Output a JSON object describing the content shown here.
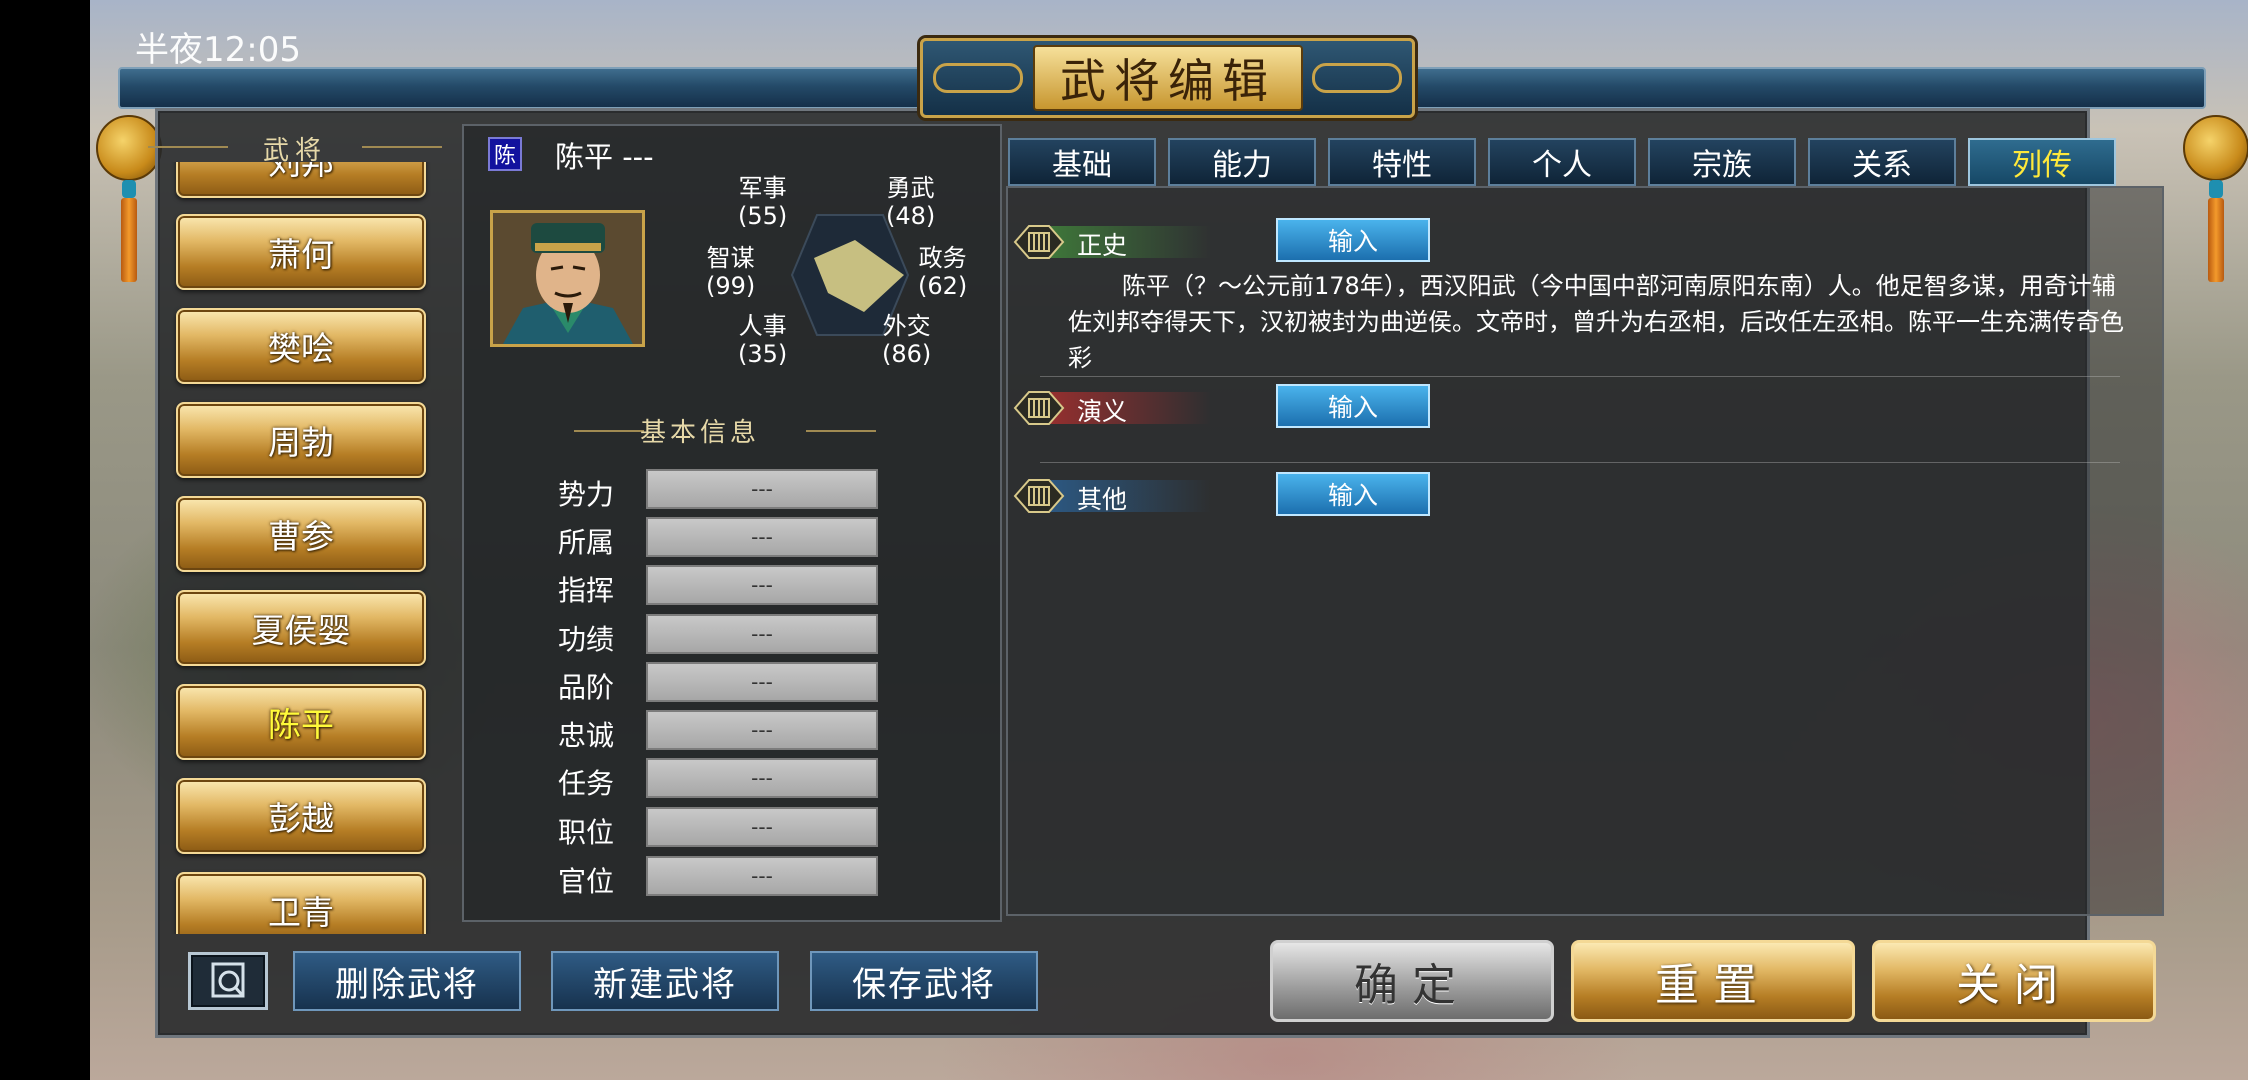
{
  "status": {
    "time": "半夜12:05"
  },
  "window": {
    "title": "武将编辑"
  },
  "list": {
    "header": "武将",
    "items": [
      {
        "name": "刘邦",
        "selected": false
      },
      {
        "name": "萧何",
        "selected": false
      },
      {
        "name": "樊哙",
        "selected": false
      },
      {
        "name": "周勃",
        "selected": false
      },
      {
        "name": "曹参",
        "selected": false
      },
      {
        "name": "夏侯婴",
        "selected": false
      },
      {
        "name": "陈平",
        "selected": true
      },
      {
        "name": "彭越",
        "selected": false
      },
      {
        "name": "卫青",
        "selected": false
      }
    ]
  },
  "general": {
    "badge": "陈",
    "name": "陈平 ---",
    "stats": {
      "military": {
        "label": "军事",
        "value": "(55)"
      },
      "valor": {
        "label": "勇武",
        "value": "(48)"
      },
      "strategy": {
        "label": "智谋",
        "value": "(99)"
      },
      "politics": {
        "label": "政务",
        "value": "(62)"
      },
      "personnel": {
        "label": "人事",
        "value": "(35)"
      },
      "diplomacy": {
        "label": "外交",
        "value": "(86)"
      }
    }
  },
  "basic": {
    "title": "基本信息",
    "fields": [
      {
        "label": "势力",
        "value": "---"
      },
      {
        "label": "所属",
        "value": "---"
      },
      {
        "label": "指挥",
        "value": "---"
      },
      {
        "label": "功绩",
        "value": "---"
      },
      {
        "label": "品阶",
        "value": "---"
      },
      {
        "label": "忠诚",
        "value": "---"
      },
      {
        "label": "任务",
        "value": "---"
      },
      {
        "label": "职位",
        "value": "---"
      },
      {
        "label": "官位",
        "value": "---"
      }
    ]
  },
  "tabs": [
    {
      "label": "基础",
      "selected": false
    },
    {
      "label": "能力",
      "selected": false
    },
    {
      "label": "特性",
      "selected": false
    },
    {
      "label": "个人",
      "selected": false
    },
    {
      "label": "宗族",
      "selected": false
    },
    {
      "label": "关系",
      "selected": false
    },
    {
      "label": "列传",
      "selected": true
    }
  ],
  "biography": {
    "input_label": "输入",
    "sections": [
      {
        "title": "正史",
        "text": "陈平（？～公元前178年），西汉阳武（今中国中部河南原阳东南）人。他足智多谋，用奇计辅佐刘邦夺得天下，汉初被封为曲逆侯。文帝时，曾升为右丞相，后改任左丞相。陈平一生充满传奇色彩",
        "color": "#3f7a3a"
      },
      {
        "title": "演义",
        "text": "",
        "color": "#9a2f2f"
      },
      {
        "title": "其他",
        "text": "",
        "color": "#2c5a86"
      }
    ]
  },
  "bottom": {
    "delete": "删除武将",
    "new": "新建武将",
    "save": "保存武将",
    "confirm": "确定",
    "reset": "重置",
    "close": "关闭"
  },
  "colors": {
    "gold": "#e2b865",
    "selected_text": "#fffa3a",
    "tab_selected": "#ffe93a",
    "blue_button": "#2f5b84"
  },
  "icons": {
    "search": "search-icon"
  }
}
